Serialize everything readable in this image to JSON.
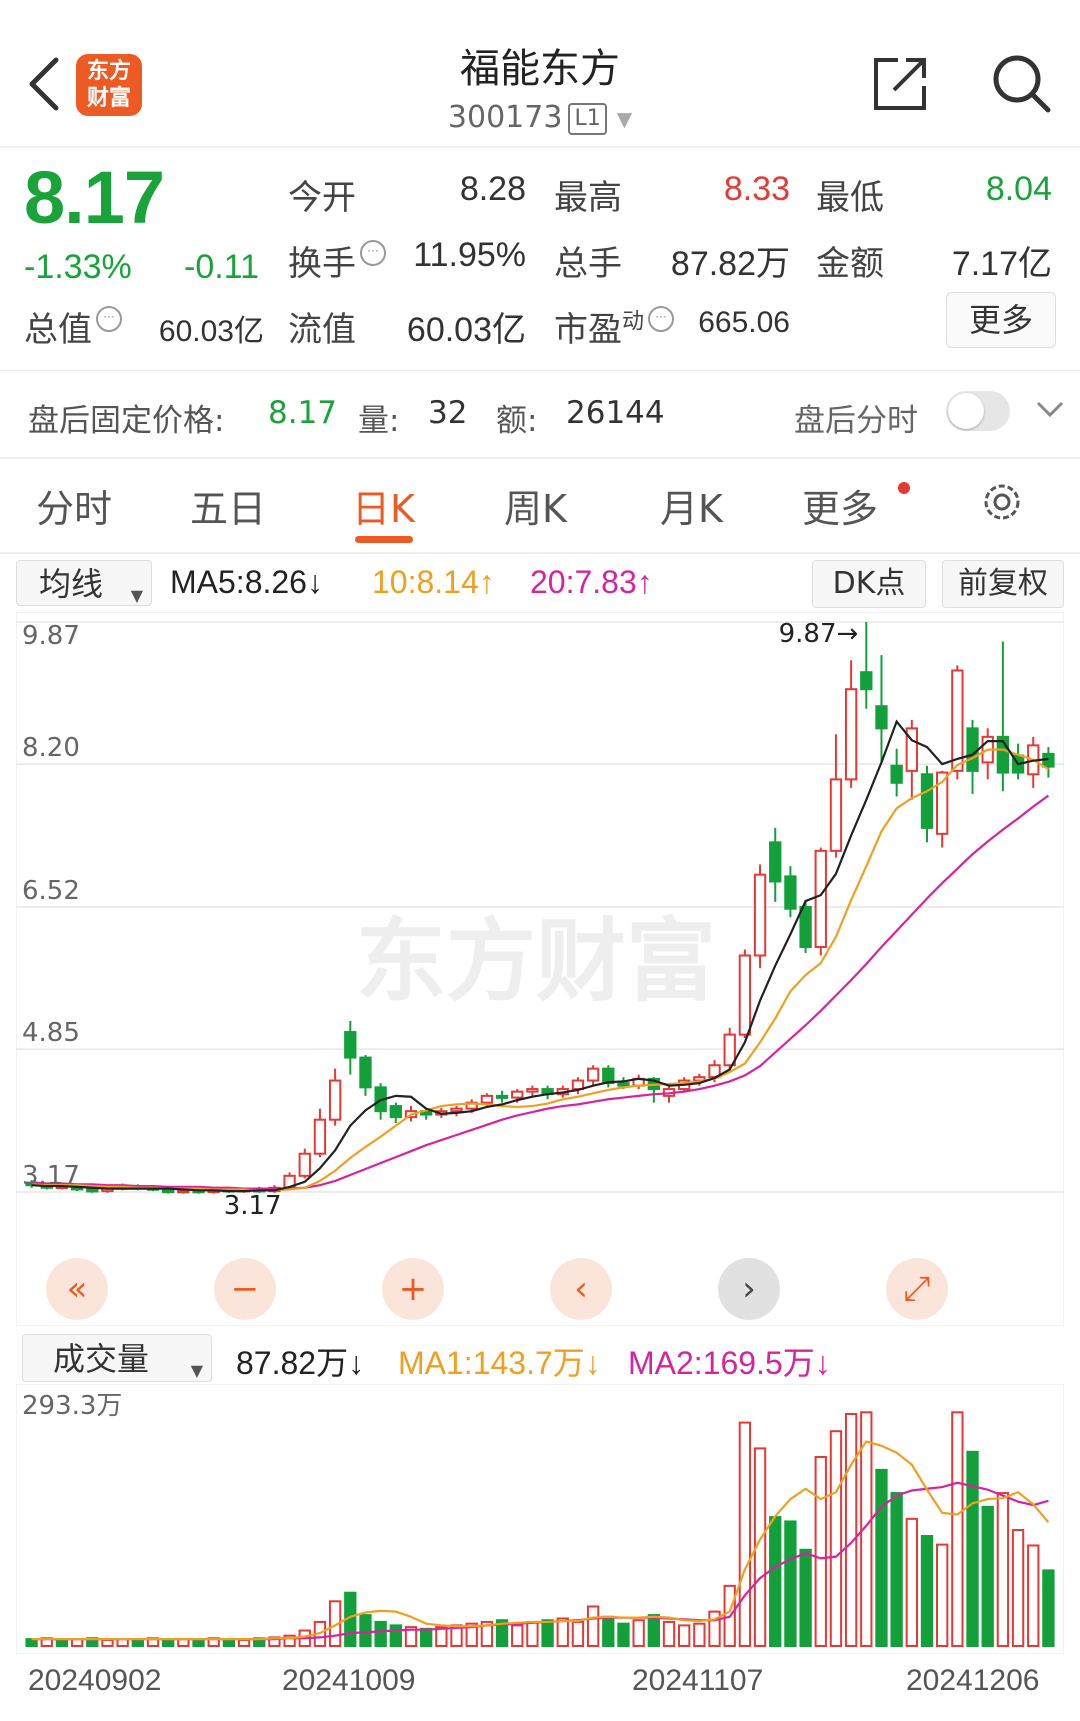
{
  "header": {
    "back_icon": "chevron-left-icon",
    "logo_text": "东方\n财富",
    "title": "福能东方",
    "code": "300173",
    "level_badge": "L1",
    "share_icon": "share-external-icon",
    "search_icon": "search-icon"
  },
  "quote": {
    "price": "8.17",
    "change_pct": "-1.33%",
    "change_abs": "-0.11",
    "open_label": "今开",
    "open": "8.28",
    "high_label": "最高",
    "high": "8.33",
    "low_label": "最低",
    "low": "8.04",
    "turnover_label": "换手",
    "turnover": "11.95%",
    "volume_label": "总手",
    "volume": "87.82万",
    "amount_label": "金额",
    "amount": "7.17亿",
    "total_value_label": "总值",
    "total_value": "60.03亿",
    "float_value_label": "流值",
    "float_value": "60.03亿",
    "pe_label": "市盈",
    "pe_sup": "动",
    "pe": "665.06",
    "more_label": "更多"
  },
  "after_hours": {
    "price_label": "盘后固定价格:",
    "price": "8.17",
    "vol_label": "量:",
    "vol": "32",
    "amount_label": "额:",
    "amount": "26144",
    "timeshare_label": "盘后分时"
  },
  "tabs": [
    "分时",
    "五日",
    "日K",
    "周K",
    "月K",
    "更多"
  ],
  "ma_bar": {
    "select": "均线",
    "ma5": "MA5:8.26↓",
    "ma10": "10:8.14↑",
    "ma20": "20:7.83↑",
    "dk": "DK点",
    "adjust": "前复权"
  },
  "price_axis": [
    "9.87",
    "8.20",
    "6.52",
    "4.85",
    "3.17"
  ],
  "high_marker": "9.87→",
  "low_marker": "3.17",
  "vol_bar": {
    "select": "成交量",
    "vol": "87.82万↓",
    "ma1": "MA1:143.7万↓",
    "ma2": "MA2:169.5万↓",
    "axis_max": "293.3万"
  },
  "dates": [
    "20240902",
    "20241009",
    "20241107",
    "20241206"
  ],
  "colors": {
    "up": "#e53935",
    "down": "#13a03b",
    "ma5": "#222222",
    "ma10": "#f0a020",
    "ma20": "#d6249f",
    "accent": "#ee5a24"
  },
  "chart_data": {
    "type": "candlestick",
    "ylim": [
      3.17,
      9.87
    ],
    "y_ticks": [
      9.87,
      8.2,
      6.52,
      4.85,
      3.17
    ],
    "candles": [
      [
        3.28,
        3.25,
        3.31,
        3.22
      ],
      [
        3.25,
        3.22,
        3.28,
        3.2
      ],
      [
        3.22,
        3.24,
        3.27,
        3.2
      ],
      [
        3.24,
        3.2,
        3.26,
        3.18
      ],
      [
        3.2,
        3.18,
        3.23,
        3.16
      ],
      [
        3.18,
        3.21,
        3.24,
        3.16
      ],
      [
        3.21,
        3.24,
        3.27,
        3.19
      ],
      [
        3.24,
        3.22,
        3.26,
        3.19
      ],
      [
        3.22,
        3.2,
        3.25,
        3.18
      ],
      [
        3.2,
        3.17,
        3.22,
        3.15
      ],
      [
        3.17,
        3.19,
        3.22,
        3.15
      ],
      [
        3.19,
        3.17,
        3.22,
        3.15
      ],
      [
        3.17,
        3.2,
        3.22,
        3.15
      ],
      [
        3.2,
        3.18,
        3.22,
        3.16
      ],
      [
        3.18,
        3.2,
        3.22,
        3.16
      ],
      [
        3.2,
        3.18,
        3.23,
        3.16
      ],
      [
        3.18,
        3.22,
        3.25,
        3.16
      ],
      [
        3.22,
        3.36,
        3.4,
        3.2
      ],
      [
        3.36,
        3.62,
        3.68,
        3.33
      ],
      [
        3.62,
        4.02,
        4.15,
        3.58
      ],
      [
        4.02,
        4.48,
        4.62,
        3.95
      ],
      [
        5.05,
        4.75,
        5.18,
        4.55
      ],
      [
        4.75,
        4.4,
        4.78,
        4.3
      ],
      [
        4.4,
        4.12,
        4.45,
        4.02
      ],
      [
        4.18,
        4.05,
        4.22,
        3.98
      ],
      [
        4.05,
        4.12,
        4.18,
        4.0
      ],
      [
        4.12,
        4.08,
        4.16,
        4.02
      ],
      [
        4.08,
        4.12,
        4.16,
        4.04
      ],
      [
        4.12,
        4.15,
        4.18,
        4.06
      ],
      [
        4.15,
        4.22,
        4.26,
        4.1
      ],
      [
        4.22,
        4.3,
        4.33,
        4.16
      ],
      [
        4.3,
        4.28,
        4.36,
        4.22
      ],
      [
        4.28,
        4.35,
        4.38,
        4.22
      ],
      [
        4.35,
        4.38,
        4.42,
        4.28
      ],
      [
        4.38,
        4.32,
        4.42,
        4.26
      ],
      [
        4.32,
        4.38,
        4.42,
        4.28
      ],
      [
        4.38,
        4.48,
        4.52,
        4.32
      ],
      [
        4.48,
        4.62,
        4.66,
        4.42
      ],
      [
        4.62,
        4.45,
        4.66,
        4.4
      ],
      [
        4.45,
        4.42,
        4.52,
        4.38
      ],
      [
        4.42,
        4.5,
        4.55,
        4.38
      ],
      [
        4.5,
        4.38,
        4.52,
        4.22
      ],
      [
        4.3,
        4.38,
        4.45,
        4.22
      ],
      [
        4.38,
        4.48,
        4.52,
        4.34
      ],
      [
        4.48,
        4.52,
        4.56,
        4.42
      ],
      [
        4.52,
        4.66,
        4.72,
        4.46
      ],
      [
        4.66,
        5.02,
        5.1,
        4.6
      ],
      [
        5.02,
        5.95,
        6.02,
        4.98
      ],
      [
        5.95,
        6.9,
        7.02,
        5.8
      ],
      [
        7.28,
        6.82,
        7.45,
        6.58
      ],
      [
        6.88,
        6.5,
        7.0,
        6.4
      ],
      [
        6.52,
        6.05,
        6.58,
        5.98
      ],
      [
        6.05,
        7.18,
        7.22,
        5.95
      ],
      [
        7.18,
        8.02,
        8.55,
        7.1
      ],
      [
        8.02,
        9.08,
        9.42,
        7.92
      ],
      [
        9.28,
        9.08,
        9.87,
        8.85
      ],
      [
        8.88,
        8.62,
        9.48,
        8.22
      ],
      [
        8.18,
        7.98,
        8.38,
        7.82
      ],
      [
        8.12,
        8.62,
        8.72,
        7.78
      ],
      [
        8.08,
        7.45,
        8.18,
        7.28
      ],
      [
        7.38,
        8.1,
        8.12,
        7.22
      ],
      [
        8.12,
        9.3,
        9.36,
        8.02
      ],
      [
        8.62,
        8.12,
        8.72,
        7.85
      ],
      [
        8.22,
        8.52,
        8.62,
        8.02
      ],
      [
        8.52,
        8.1,
        9.64,
        7.88
      ],
      [
        8.3,
        8.1,
        8.44,
        8.02
      ],
      [
        8.08,
        8.42,
        8.52,
        7.92
      ],
      [
        8.32,
        8.17,
        8.4,
        8.04
      ]
    ],
    "ma5": [
      3.25,
      3.24,
      3.24,
      3.23,
      3.22,
      3.21,
      3.21,
      3.21,
      3.21,
      3.21,
      3.2,
      3.19,
      3.19,
      3.18,
      3.18,
      3.19,
      3.19,
      3.23,
      3.29,
      3.45,
      3.66,
      3.95,
      4.13,
      4.25,
      4.3,
      4.29,
      4.15,
      4.09,
      4.1,
      4.12,
      4.17,
      4.2,
      4.25,
      4.29,
      4.32,
      4.34,
      4.37,
      4.42,
      4.46,
      4.47,
      4.5,
      4.48,
      4.42,
      4.43,
      4.45,
      4.51,
      4.61,
      4.93,
      5.42,
      5.83,
      6.2,
      6.59,
      6.66,
      6.91,
      7.36,
      7.78,
      8.22,
      8.7,
      8.48,
      8.4,
      8.2,
      8.26,
      8.31,
      8.47,
      8.47,
      8.2,
      8.24,
      8.26
    ],
    "ma10": [
      3.26,
      3.25,
      3.25,
      3.25,
      3.24,
      3.23,
      3.23,
      3.22,
      3.22,
      3.21,
      3.21,
      3.21,
      3.2,
      3.2,
      3.2,
      3.19,
      3.19,
      3.2,
      3.22,
      3.3,
      3.42,
      3.57,
      3.7,
      3.82,
      3.95,
      4.08,
      4.13,
      4.18,
      4.2,
      4.21,
      4.2,
      4.18,
      4.17,
      4.18,
      4.21,
      4.26,
      4.29,
      4.33,
      4.37,
      4.4,
      4.42,
      4.43,
      4.44,
      4.45,
      4.47,
      4.5,
      4.58,
      4.68,
      4.93,
      5.21,
      5.53,
      5.72,
      5.86,
      6.17,
      6.6,
      7.0,
      7.41,
      7.68,
      7.8,
      7.88,
      7.99,
      8.19,
      8.27,
      8.37,
      8.37,
      8.31,
      8.25,
      8.14
    ],
    "ma20": [
      3.28,
      3.27,
      3.27,
      3.26,
      3.26,
      3.25,
      3.25,
      3.24,
      3.24,
      3.23,
      3.23,
      3.23,
      3.22,
      3.22,
      3.21,
      3.21,
      3.21,
      3.21,
      3.22,
      3.25,
      3.3,
      3.37,
      3.44,
      3.51,
      3.58,
      3.65,
      3.72,
      3.78,
      3.84,
      3.9,
      3.96,
      4.02,
      4.07,
      4.11,
      4.15,
      4.18,
      4.2,
      4.23,
      4.26,
      4.28,
      4.3,
      4.32,
      4.33,
      4.35,
      4.38,
      4.42,
      4.47,
      4.54,
      4.65,
      4.81,
      4.97,
      5.13,
      5.3,
      5.48,
      5.66,
      5.85,
      6.05,
      6.24,
      6.43,
      6.62,
      6.8,
      6.97,
      7.14,
      7.29,
      7.43,
      7.56,
      7.7,
      7.83
    ],
    "volume_max": 293.3,
    "volume": [
      8,
      9,
      7,
      8,
      9,
      7,
      8,
      8,
      9,
      7,
      8,
      7,
      9,
      8,
      7,
      9,
      10,
      12,
      18,
      28,
      52,
      62,
      36,
      28,
      24,
      22,
      20,
      22,
      24,
      26,
      28,
      30,
      24,
      28,
      30,
      32,
      28,
      46,
      34,
      26,
      30,
      36,
      28,
      24,
      26,
      40,
      70,
      260,
      230,
      150,
      145,
      112,
      220,
      250,
      270,
      272,
      205,
      178,
      148,
      128,
      118,
      272,
      226,
      162,
      178,
      135,
      117,
      88
    ],
    "volume_up": [
      0,
      1,
      0,
      1,
      0,
      1,
      1,
      0,
      1,
      0,
      1,
      0,
      1,
      0,
      1,
      0,
      1,
      1,
      1,
      1,
      1,
      0,
      0,
      0,
      0,
      1,
      0,
      1,
      1,
      1,
      1,
      0,
      1,
      1,
      0,
      1,
      1,
      1,
      0,
      0,
      1,
      0,
      1,
      1,
      1,
      1,
      1,
      1,
      1,
      0,
      0,
      0,
      1,
      1,
      1,
      1,
      0,
      0,
      1,
      0,
      1,
      1,
      0,
      0,
      1,
      1,
      1,
      0
    ],
    "vol_ma1": [
      8,
      8,
      8,
      8,
      8,
      8,
      8,
      8,
      8,
      8,
      8,
      8,
      8,
      8,
      8,
      8,
      9,
      9,
      11,
      15,
      24,
      34,
      39,
      41,
      40,
      34,
      26,
      24,
      23,
      23,
      24,
      26,
      27,
      28,
      28,
      29,
      29,
      33,
      34,
      33,
      33,
      34,
      33,
      30,
      29,
      31,
      40,
      89,
      124,
      151,
      171,
      183,
      171,
      179,
      211,
      238,
      233,
      225,
      211,
      182,
      155,
      153,
      166,
      171,
      172,
      179,
      165,
      144
    ],
    "vol_ma2": [
      8,
      8,
      8,
      8,
      8,
      8,
      8,
      8,
      8,
      8,
      8,
      8,
      8,
      8,
      8,
      8,
      8,
      9,
      9,
      10,
      12,
      15,
      16,
      17,
      18,
      19,
      19,
      20,
      21,
      22,
      24,
      25,
      26,
      27,
      28,
      29,
      30,
      32,
      33,
      33,
      33,
      33,
      32,
      31,
      30,
      30,
      34,
      59,
      79,
      92,
      101,
      108,
      102,
      104,
      120,
      140,
      162,
      175,
      181,
      183,
      185,
      190,
      186,
      182,
      175,
      168,
      164,
      169
    ]
  }
}
